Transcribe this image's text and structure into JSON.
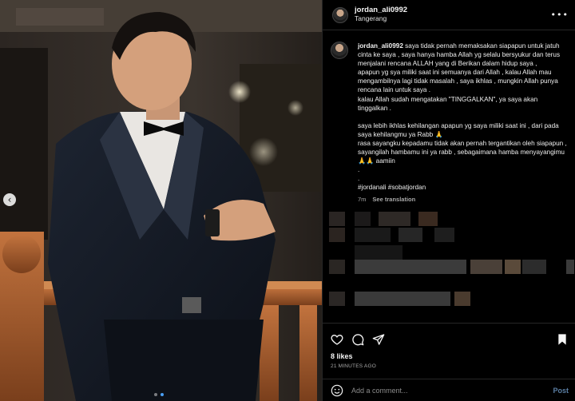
{
  "post": {
    "username": "jordan_ali0992",
    "location": "Tangerang",
    "more_icon": "more-horizontal-icon"
  },
  "caption": {
    "username": "jordan_ali0992",
    "lines": [
      "saya tidak pernah memaksakan siapapun untuk jatuh cinta ke saya , saya hanya hamba Allah yg selalu bersyukur dan terus menjalani rencana ALLAH yang di Berikan dalam hidup saya ,",
      "apapun yg sya miliki saat ini semuanya dari Allah , kalau Allah mau mengambilnya lagi tidak masalah , saya ikhlas , mungkin Allah punya rencana lain untuk saya .",
      "kalau Allah sudah mengatakan \"TINGGALKAN\", ya saya akan tinggalkan ."
    ],
    "lines2": [
      "saya lebih ikhlas kehilangan apapun yg saya miliki saat ini , dari pada saya kehilangmu ya Rabb 🙏",
      "rasa sayangku kepadamu tidak akan pernah tergantikan oleh siapapun , sayangilah hambamu ini ya rabb , sebagaimana hamba menyayangimu 🙏🙏 aamiin",
      ".",
      "."
    ],
    "hashtags": "#jordanali #sobatjordan",
    "age": "7m",
    "see_translation": "See translation"
  },
  "actions": {
    "like_icon": "heart-icon",
    "comment_icon": "comment-icon",
    "share_icon": "send-icon",
    "save_icon": "bookmark-icon"
  },
  "likes": "8 likes",
  "timestamp": "21 MINUTES AGO",
  "comment_box": {
    "placeholder": "Add a comment...",
    "post_label": "Post",
    "emoji_icon": "emoji-icon"
  },
  "colors": {
    "background": "#000000",
    "accent_blue": "#0095f6",
    "muted_text": "#a8a8a8"
  }
}
